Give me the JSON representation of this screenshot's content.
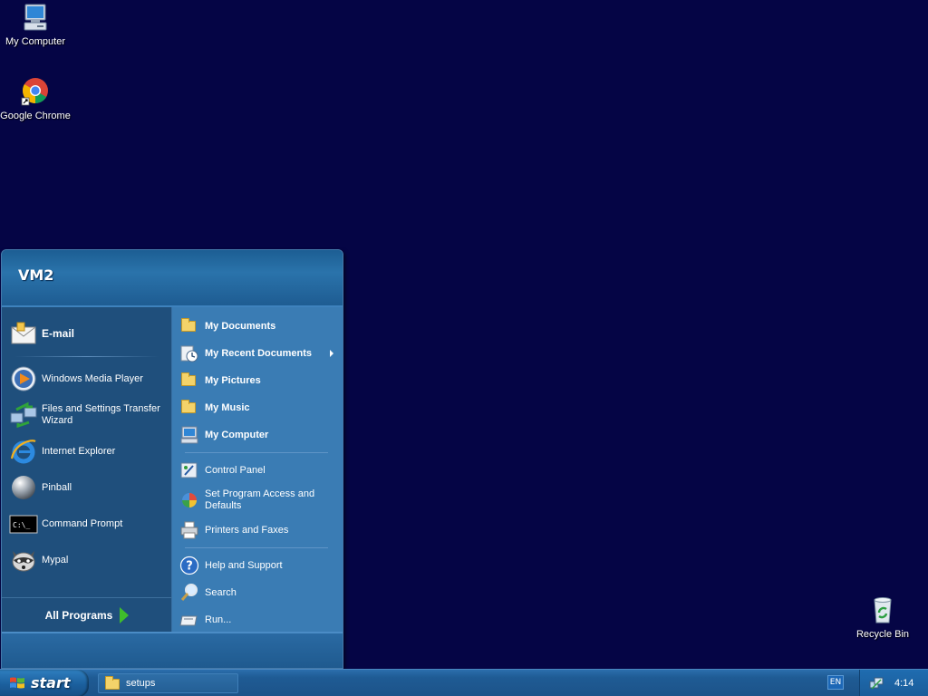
{
  "desktop": {
    "icons": [
      {
        "label": "My Computer"
      },
      {
        "label": "Google Chrome"
      },
      {
        "label": "Recycle Bin"
      }
    ]
  },
  "start_menu": {
    "user": "VM2",
    "left_items": [
      {
        "label": "E-mail",
        "icon": "email-icon"
      },
      {
        "label": "Windows Media Player",
        "icon": "media-player-icon"
      },
      {
        "label": "Files and Settings Transfer Wizard",
        "icon": "transfer-wizard-icon"
      },
      {
        "label": "Internet Explorer",
        "icon": "internet-explorer-icon"
      },
      {
        "label": "Pinball",
        "icon": "pinball-icon"
      },
      {
        "label": "Command Prompt",
        "icon": "command-prompt-icon"
      },
      {
        "label": "Mypal",
        "icon": "mypal-icon"
      }
    ],
    "all_programs": "All Programs",
    "right_items": [
      {
        "label": "My Documents",
        "icon": "documents-folder-icon"
      },
      {
        "label": "My Recent Documents",
        "icon": "recent-documents-icon"
      },
      {
        "label": "My Pictures",
        "icon": "pictures-folder-icon"
      },
      {
        "label": "My Music",
        "icon": "music-folder-icon"
      },
      {
        "label": "My Computer",
        "icon": "computer-icon"
      },
      {
        "label": "Control Panel",
        "icon": "control-panel-icon"
      },
      {
        "label": "Set Program Access and Defaults",
        "icon": "program-access-icon"
      },
      {
        "label": "Printers and Faxes",
        "icon": "printer-icon"
      },
      {
        "label": "Help and Support",
        "icon": "help-icon"
      },
      {
        "label": "Search",
        "icon": "search-icon"
      },
      {
        "label": "Run...",
        "icon": "run-icon"
      }
    ],
    "command_prompt_glyph": "C:\\_"
  },
  "taskbar": {
    "start_label": "start",
    "task_label": "setups",
    "language": "EN",
    "clock": "4:14"
  },
  "colors": {
    "desktop_bg": "#050545",
    "taskbar": "#1f5b94",
    "start_menu_left": "#1f4f7c",
    "start_menu_right": "#3a7cb4",
    "all_programs_arrow": "#3fbd2c"
  }
}
